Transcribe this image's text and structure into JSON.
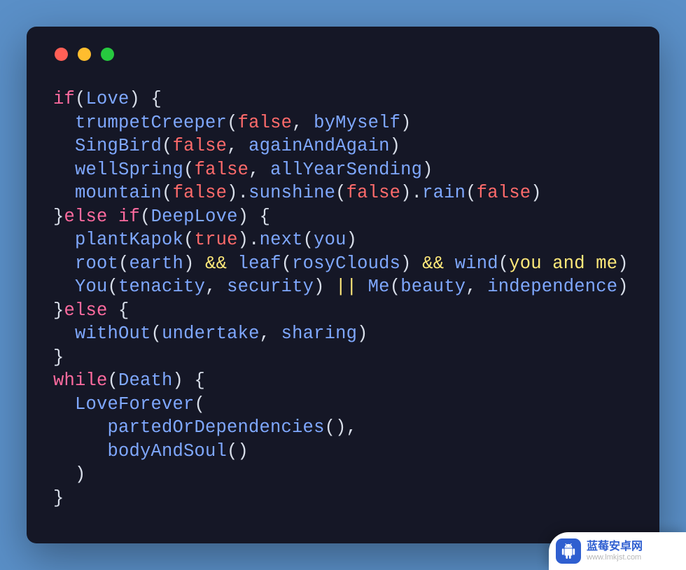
{
  "code": {
    "tokens": [
      [
        {
          "t": "if",
          "c": "kw"
        },
        {
          "t": "(",
          "c": "pn"
        },
        {
          "t": "Love",
          "c": "id"
        },
        {
          "t": ") {",
          "c": "pn"
        }
      ],
      [
        {
          "t": "  "
        },
        {
          "t": "trumpetCreeper",
          "c": "id"
        },
        {
          "t": "(",
          "c": "pn"
        },
        {
          "t": "false",
          "c": "bool"
        },
        {
          "t": ", ",
          "c": "pn"
        },
        {
          "t": "byMyself",
          "c": "id"
        },
        {
          "t": ")",
          "c": "pn"
        }
      ],
      [
        {
          "t": "  "
        },
        {
          "t": "SingBird",
          "c": "id"
        },
        {
          "t": "(",
          "c": "pn"
        },
        {
          "t": "false",
          "c": "bool"
        },
        {
          "t": ", ",
          "c": "pn"
        },
        {
          "t": "againAndAgain",
          "c": "id"
        },
        {
          "t": ")",
          "c": "pn"
        }
      ],
      [
        {
          "t": "  "
        },
        {
          "t": "wellSpring",
          "c": "id"
        },
        {
          "t": "(",
          "c": "pn"
        },
        {
          "t": "false",
          "c": "bool"
        },
        {
          "t": ", ",
          "c": "pn"
        },
        {
          "t": "allYearSending",
          "c": "id"
        },
        {
          "t": ")",
          "c": "pn"
        }
      ],
      [
        {
          "t": "  "
        },
        {
          "t": "mountain",
          "c": "id"
        },
        {
          "t": "(",
          "c": "pn"
        },
        {
          "t": "false",
          "c": "bool"
        },
        {
          "t": ").",
          "c": "pn"
        },
        {
          "t": "sunshine",
          "c": "id"
        },
        {
          "t": "(",
          "c": "pn"
        },
        {
          "t": "false",
          "c": "bool"
        },
        {
          "t": ").",
          "c": "pn"
        },
        {
          "t": "rain",
          "c": "id"
        },
        {
          "t": "(",
          "c": "pn"
        },
        {
          "t": "false",
          "c": "bool"
        },
        {
          "t": ")",
          "c": "pn"
        }
      ],
      [
        {
          "t": "}",
          "c": "pn"
        },
        {
          "t": "else if",
          "c": "kw"
        },
        {
          "t": "(",
          "c": "pn"
        },
        {
          "t": "DeepLove",
          "c": "id"
        },
        {
          "t": ") {",
          "c": "pn"
        }
      ],
      [
        {
          "t": "  "
        },
        {
          "t": "plantKapok",
          "c": "id"
        },
        {
          "t": "(",
          "c": "pn"
        },
        {
          "t": "true",
          "c": "bool"
        },
        {
          "t": ").",
          "c": "pn"
        },
        {
          "t": "next",
          "c": "id"
        },
        {
          "t": "(",
          "c": "pn"
        },
        {
          "t": "you",
          "c": "id"
        },
        {
          "t": ")",
          "c": "pn"
        }
      ],
      [
        {
          "t": "  "
        },
        {
          "t": "root",
          "c": "id"
        },
        {
          "t": "(",
          "c": "pn"
        },
        {
          "t": "earth",
          "c": "id"
        },
        {
          "t": ") ",
          "c": "pn"
        },
        {
          "t": "&&",
          "c": "op"
        },
        {
          "t": " ",
          "c": "pn"
        },
        {
          "t": "leaf",
          "c": "id"
        },
        {
          "t": "(",
          "c": "pn"
        },
        {
          "t": "rosyClouds",
          "c": "id"
        },
        {
          "t": ") ",
          "c": "pn"
        },
        {
          "t": "&&",
          "c": "op"
        },
        {
          "t": " ",
          "c": "pn"
        },
        {
          "t": "wind",
          "c": "id"
        },
        {
          "t": "(",
          "c": "pn"
        },
        {
          "t": "you and me",
          "c": "str"
        },
        {
          "t": ")",
          "c": "pn"
        }
      ],
      [
        {
          "t": "  "
        },
        {
          "t": "You",
          "c": "id"
        },
        {
          "t": "(",
          "c": "pn"
        },
        {
          "t": "tenacity",
          "c": "id"
        },
        {
          "t": ", ",
          "c": "pn"
        },
        {
          "t": "security",
          "c": "id"
        },
        {
          "t": ") ",
          "c": "pn"
        },
        {
          "t": "||",
          "c": "op"
        },
        {
          "t": " ",
          "c": "pn"
        },
        {
          "t": "Me",
          "c": "id"
        },
        {
          "t": "(",
          "c": "pn"
        },
        {
          "t": "beauty",
          "c": "id"
        },
        {
          "t": ", ",
          "c": "pn"
        },
        {
          "t": "independence",
          "c": "id"
        },
        {
          "t": ")",
          "c": "pn"
        }
      ],
      [
        {
          "t": "}",
          "c": "pn"
        },
        {
          "t": "else",
          "c": "kw"
        },
        {
          "t": " {",
          "c": "pn"
        }
      ],
      [
        {
          "t": "  "
        },
        {
          "t": "withOut",
          "c": "id"
        },
        {
          "t": "(",
          "c": "pn"
        },
        {
          "t": "undertake",
          "c": "id"
        },
        {
          "t": ", ",
          "c": "pn"
        },
        {
          "t": "sharing",
          "c": "id"
        },
        {
          "t": ")",
          "c": "pn"
        }
      ],
      [
        {
          "t": "}",
          "c": "pn"
        }
      ],
      [
        {
          "t": "while",
          "c": "kw"
        },
        {
          "t": "(",
          "c": "pn"
        },
        {
          "t": "Death",
          "c": "id"
        },
        {
          "t": ") {",
          "c": "pn"
        }
      ],
      [
        {
          "t": "  "
        },
        {
          "t": "LoveForever",
          "c": "id"
        },
        {
          "t": "(",
          "c": "pn"
        }
      ],
      [
        {
          "t": "     "
        },
        {
          "t": "partedOrDependencies",
          "c": "id"
        },
        {
          "t": "(),",
          "c": "pn"
        }
      ],
      [
        {
          "t": "     "
        },
        {
          "t": "bodyAndSoul",
          "c": "id"
        },
        {
          "t": "()",
          "c": "pn"
        }
      ],
      [
        {
          "t": "  )",
          "c": "pn"
        }
      ],
      [
        {
          "t": "}",
          "c": "pn"
        }
      ]
    ]
  },
  "badge": {
    "title": "蓝莓安卓网",
    "url": "www.lmkjst.com"
  }
}
